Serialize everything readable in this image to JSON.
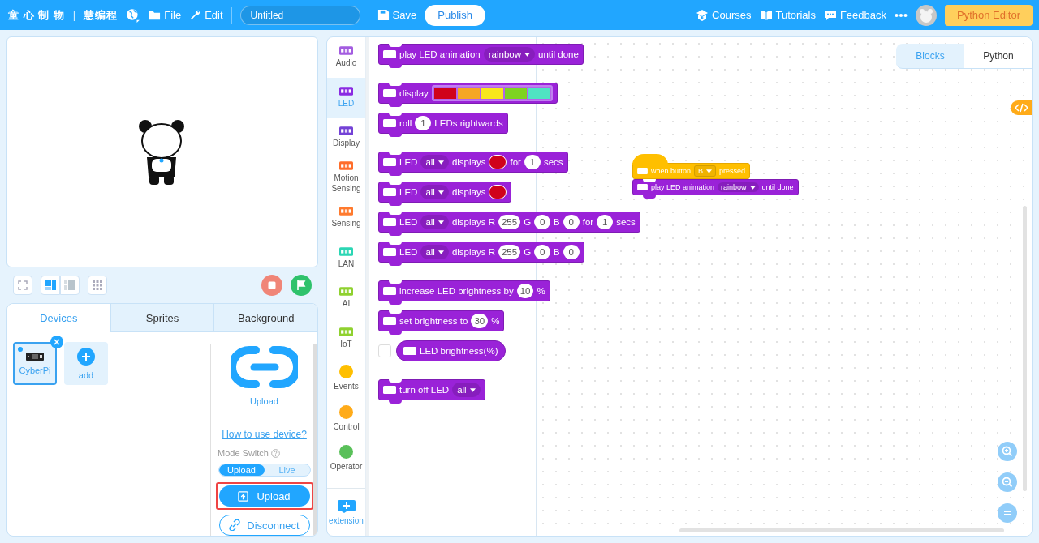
{
  "top_bar": {
    "brand": "童 心 制 物",
    "separator": "|",
    "product": "慧编程",
    "menus": [
      {
        "label": "File"
      },
      {
        "label": "Edit"
      }
    ],
    "project_title": "Untitled",
    "save": "Save",
    "publish": "Publish",
    "links": [
      {
        "label": "Courses"
      },
      {
        "label": "Tutorials"
      },
      {
        "label": "Feedback"
      }
    ],
    "python_editor": "Python Editor"
  },
  "stage_toolbar": {
    "layouts": [
      {
        "selected": true
      },
      {
        "selected": false
      }
    ]
  },
  "panel_tabs": [
    {
      "label": "Devices",
      "selected": true
    },
    {
      "label": "Sprites",
      "selected": false
    },
    {
      "label": "Background",
      "selected": false
    }
  ],
  "devices": [
    {
      "name": "CyberPi",
      "selected": true
    }
  ],
  "add_device": "add",
  "device_actions": {
    "connect_label": "Upload",
    "help_link": "How to use device?",
    "mode_label": "Mode Switch",
    "modes": [
      {
        "label": "Upload",
        "selected": true
      },
      {
        "label": "Live",
        "selected": false
      }
    ],
    "upload_button": "Upload",
    "upload_highlighted": true,
    "disconnect_button": "Disconnect"
  },
  "categories": [
    {
      "label": "Audio",
      "kind": "device",
      "color": "#a35ce0",
      "selected": false
    },
    {
      "label": "LED",
      "kind": "device",
      "color": "#8a2be2",
      "selected": true
    },
    {
      "label": "Display",
      "kind": "device",
      "color": "#7442d6",
      "selected": false
    },
    {
      "label": "Motion Sensing",
      "kind": "device",
      "color": "#ff6d2a",
      "selected": false
    },
    {
      "label": "Sensing",
      "kind": "device",
      "color": "#ff7a2e",
      "selected": false
    },
    {
      "label": "LAN",
      "kind": "device",
      "color": "#2bd6b4",
      "selected": false
    },
    {
      "label": "AI",
      "kind": "device",
      "color": "#8fd12f",
      "selected": false
    },
    {
      "label": "IoT",
      "kind": "device",
      "color": "#8fd12f",
      "selected": false
    },
    {
      "label": "Events",
      "kind": "circle",
      "color": "#ffbf00",
      "selected": false
    },
    {
      "label": "Control",
      "kind": "circle",
      "color": "#ffab19",
      "selected": false
    },
    {
      "label": "Operator",
      "kind": "circle",
      "color": "#59c059",
      "selected": false
    }
  ],
  "extension": "extension",
  "palette_groups": [
    [
      {
        "kind": "stack",
        "parts": [
          {
            "kind": "text",
            "text": "play LED animation"
          },
          {
            "kind": "dropdown",
            "text": "rainbow"
          },
          {
            "kind": "text",
            "text": "until done"
          }
        ]
      }
    ],
    [
      {
        "kind": "stack",
        "parts": [
          {
            "kind": "text",
            "text": "display"
          },
          {
            "kind": "palette",
            "colors": [
              {
                "color": "#d0021b"
              },
              {
                "color": "#f5a623"
              },
              {
                "color": "#f8e71c"
              },
              {
                "color": "#7ed321"
              },
              {
                "color": "#50e3c2"
              }
            ]
          }
        ]
      },
      {
        "kind": "stack",
        "parts": [
          {
            "kind": "text",
            "text": "roll"
          },
          {
            "kind": "number",
            "text": "1"
          },
          {
            "kind": "text",
            "text": "LEDs rightwards"
          }
        ]
      }
    ],
    [
      {
        "kind": "stack",
        "parts": [
          {
            "kind": "text",
            "text": "LED"
          },
          {
            "kind": "dropdown",
            "text": "all"
          },
          {
            "kind": "text",
            "text": "displays"
          },
          {
            "kind": "color",
            "color": "#d0021b"
          },
          {
            "kind": "text",
            "text": "for"
          },
          {
            "kind": "number",
            "text": "1"
          },
          {
            "kind": "text",
            "text": "secs"
          }
        ]
      },
      {
        "kind": "stack",
        "parts": [
          {
            "kind": "text",
            "text": "LED"
          },
          {
            "kind": "dropdown",
            "text": "all"
          },
          {
            "kind": "text",
            "text": "displays"
          },
          {
            "kind": "color",
            "color": "#d0021b"
          }
        ]
      },
      {
        "kind": "stack",
        "parts": [
          {
            "kind": "text",
            "text": "LED"
          },
          {
            "kind": "dropdown",
            "text": "all"
          },
          {
            "kind": "text",
            "text": "displays R"
          },
          {
            "kind": "number",
            "text": "255"
          },
          {
            "kind": "text",
            "text": "G"
          },
          {
            "kind": "number",
            "text": "0"
          },
          {
            "kind": "text",
            "text": "B"
          },
          {
            "kind": "number",
            "text": "0"
          },
          {
            "kind": "text",
            "text": "for"
          },
          {
            "kind": "number",
            "text": "1"
          },
          {
            "kind": "text",
            "text": "secs"
          }
        ]
      },
      {
        "kind": "stack",
        "parts": [
          {
            "kind": "text",
            "text": "LED"
          },
          {
            "kind": "dropdown",
            "text": "all"
          },
          {
            "kind": "text",
            "text": "displays R"
          },
          {
            "kind": "number",
            "text": "255"
          },
          {
            "kind": "text",
            "text": "G"
          },
          {
            "kind": "number",
            "text": "0"
          },
          {
            "kind": "text",
            "text": "B"
          },
          {
            "kind": "number",
            "text": "0"
          }
        ]
      }
    ],
    [
      {
        "kind": "stack",
        "parts": [
          {
            "kind": "text",
            "text": "increase LED brightness by"
          },
          {
            "kind": "number",
            "text": "10"
          },
          {
            "kind": "text",
            "text": "%"
          }
        ]
      },
      {
        "kind": "stack",
        "parts": [
          {
            "kind": "text",
            "text": "set brightness to"
          },
          {
            "kind": "number",
            "text": "30"
          },
          {
            "kind": "text",
            "text": "%"
          }
        ]
      },
      {
        "kind": "reporter",
        "checked": false,
        "parts": [
          {
            "kind": "text",
            "text": "LED brightness(%)"
          }
        ]
      }
    ],
    [
      {
        "kind": "stack",
        "parts": [
          {
            "kind": "text",
            "text": "turn off LED"
          },
          {
            "kind": "dropdown",
            "text": "all"
          }
        ]
      }
    ]
  ],
  "editor_tabs": [
    {
      "label": "Blocks",
      "selected": true
    },
    {
      "label": "Python",
      "selected": false
    }
  ],
  "script": [
    {
      "kind": "hat",
      "parts": [
        {
          "kind": "text",
          "text": "when button"
        },
        {
          "kind": "dropdown",
          "text": "B"
        },
        {
          "kind": "text",
          "text": "pressed"
        }
      ]
    },
    {
      "kind": "stack",
      "parts": [
        {
          "kind": "text",
          "text": "play LED animation"
        },
        {
          "kind": "dropdown",
          "text": "rainbow"
        },
        {
          "kind": "text",
          "text": "until done"
        }
      ]
    }
  ]
}
